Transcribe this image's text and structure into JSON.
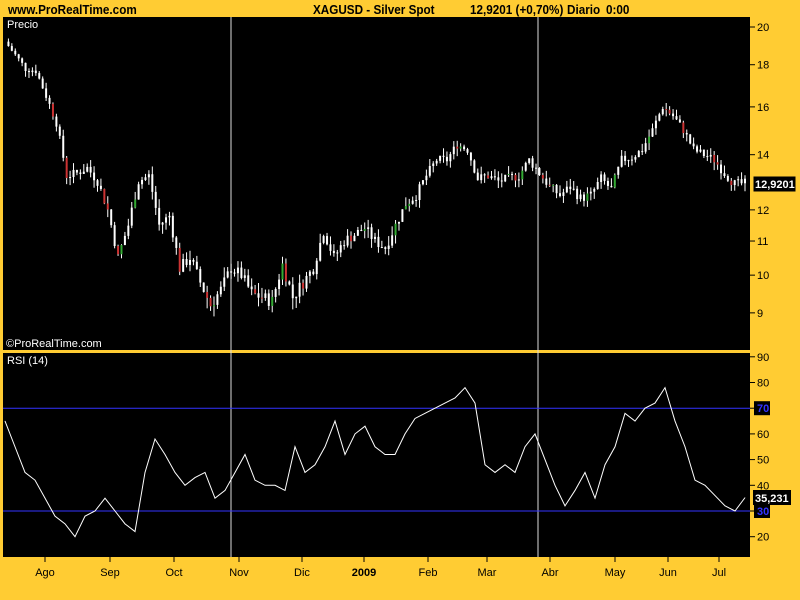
{
  "header": {
    "site": "www.ProRealTime.com",
    "title": "XAGUSD - Silver Spot",
    "quote": "12,9201 (+0,70%)",
    "period": "Diario",
    "time": "0:00"
  },
  "colors": {
    "background": "#FFCC33",
    "plot": "#000000",
    "candle": "#FFFFFF",
    "up": "#33AA33",
    "down": "#CC3333",
    "rsi_line": "#FFFFFF",
    "rsi_levels": "#3333FF"
  },
  "chart_data": [
    {
      "type": "candlestick",
      "title": "Precio",
      "watermark": "©ProRealTime.com",
      "scale": "log",
      "ylim": [
        8.5,
        20.5
      ],
      "yticks": [
        9,
        10,
        11,
        12,
        14,
        16,
        18,
        20
      ],
      "last_value": "12,9201",
      "x_labels": [
        "Ago",
        "Sep",
        "Oct",
        "Nov",
        "Dic",
        "2009",
        "Feb",
        "Mar",
        "Abr",
        "May",
        "Jun",
        "Jul"
      ],
      "close": [
        19.2,
        18.5,
        17.8,
        17.7,
        16.5,
        15.3,
        13.2,
        13.3,
        13.5,
        13.0,
        12.0,
        10.5,
        11.5,
        13.0,
        13.2,
        11.5,
        11.8,
        10.2,
        10.5,
        9.8,
        9.2,
        9.6,
        10.2,
        10.0,
        9.5,
        9.4,
        9.3,
        10.3,
        9.4,
        9.8,
        10.2,
        11.3,
        10.5,
        11.0,
        11.2,
        11.4,
        11.0,
        10.8,
        11.5,
        12.2,
        12.5,
        13.2,
        13.8,
        13.8,
        14.4,
        14.2,
        13.1,
        13.2,
        13.0,
        13.1,
        13.2,
        13.8,
        13.3,
        12.8,
        12.5,
        12.8,
        12.4,
        12.5,
        13.1,
        12.7,
        13.8,
        13.9,
        14.2,
        15.0,
        16.0,
        15.6,
        15.0,
        14.2,
        14.0,
        13.8,
        13.3,
        12.9,
        12.92
      ]
    },
    {
      "type": "line",
      "title": "RSI (14)",
      "ylim": [
        15,
        92
      ],
      "yticks": [
        20,
        30,
        40,
        50,
        60,
        70,
        80,
        90
      ],
      "levels": [
        70,
        30
      ],
      "last_value": "35,231",
      "values": [
        65,
        55,
        45,
        42,
        35,
        28,
        25,
        20,
        28,
        30,
        35,
        30,
        25,
        22,
        45,
        58,
        52,
        45,
        40,
        43,
        45,
        35,
        38,
        45,
        52,
        42,
        40,
        40,
        38,
        55,
        45,
        48,
        55,
        65,
        52,
        60,
        63,
        55,
        52,
        52,
        60,
        66,
        68,
        70,
        72,
        74,
        78,
        72,
        48,
        45,
        48,
        45,
        55,
        60,
        50,
        40,
        32,
        38,
        45,
        35,
        48,
        55,
        68,
        65,
        70,
        72,
        78,
        65,
        55,
        42,
        40,
        36,
        32,
        30,
        35.2
      ]
    }
  ]
}
